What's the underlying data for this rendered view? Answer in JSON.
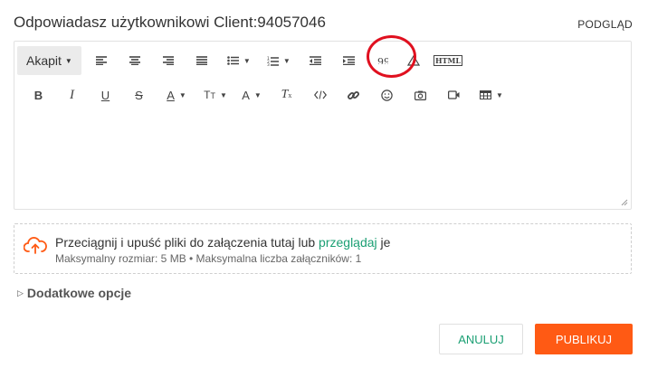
{
  "header": {
    "title": "Odpowiadasz użytkownikowi Client:94057046",
    "preview_label": "PODGLĄD"
  },
  "toolbar": {
    "paragraph_label": "Akapit",
    "icons_row1": [
      "align-left-icon",
      "align-center-icon",
      "align-right-icon",
      "align-justify-icon",
      "bulleted-list-icon",
      "numbered-list-icon",
      "outdent-icon",
      "indent-icon",
      "blockquote-icon",
      "warning-icon",
      "html-icon"
    ],
    "icons_row2": [
      "bold-icon",
      "italic-icon",
      "underline-icon",
      "strikethrough-icon",
      "text-color-icon",
      "font-size-icon",
      "font-family-icon",
      "clear-formatting-icon",
      "code-icon",
      "link-icon",
      "emoji-icon",
      "image-icon",
      "video-icon",
      "table-icon"
    ],
    "html_label": "HTML",
    "bold": "B",
    "italic": "I",
    "underline": "U",
    "strike": "S",
    "text_color": "A",
    "font_size": "TT",
    "font_family": "A"
  },
  "upload": {
    "text_before": "Przeciągnij i upuść pliki do załączenia tutaj lub ",
    "link_text": "przeglądaj",
    "text_after": " je",
    "limits": "Maksymalny rozmiar: 5 MB • Maksymalna liczba załączników: 1"
  },
  "more_options": "Dodatkowe opcje",
  "actions": {
    "cancel": "ANULUJ",
    "publish": "PUBLIKUJ"
  },
  "colors": {
    "accent_green": "#1a9f73",
    "publish_orange": "#ff5a14",
    "annotation_red": "#e0101f"
  }
}
